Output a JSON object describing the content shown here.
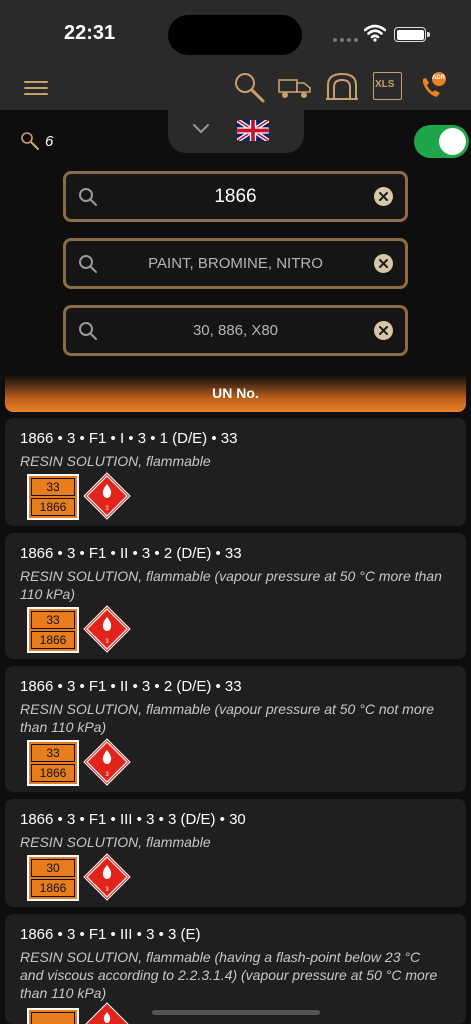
{
  "status": {
    "time": "22:31"
  },
  "nav": {
    "icons": [
      "menu-icon",
      "search-icon",
      "truck-icon",
      "tunnel-icon",
      "xls-icon",
      "adr-phone-icon"
    ],
    "xls_label": "XLS",
    "adr_label": "ADR"
  },
  "header": {
    "result_count": "6",
    "toggle_on": true
  },
  "colors": {
    "accent": "#e98125",
    "field_border": "#8a6d44",
    "toggle": "#1fa64a",
    "hazard": "#e2231a"
  },
  "search": {
    "un_value": "1866",
    "name_placeholder": "PAINT, BROMINE, NITRO",
    "code_placeholder": "30, 886, X80"
  },
  "section_title": "UN No.",
  "results": [
    {
      "title": "1866 • 3 • F1 • I • 3 • 1 (D/E) • 33",
      "description": "RESIN SOLUTION, flammable",
      "plate_top": "33",
      "plate_bottom": "1866",
      "label_class": "3"
    },
    {
      "title": "1866 • 3 • F1 • II • 3 • 2 (D/E) • 33",
      "description": "RESIN SOLUTION, flammable (vapour pressure at 50 °C more than 110 kPa)",
      "plate_top": "33",
      "plate_bottom": "1866",
      "label_class": "3"
    },
    {
      "title": "1866 • 3 • F1 • II • 3 • 2 (D/E) • 33",
      "description": "RESIN SOLUTION, flammable (vapour pressure at 50 °C not more than 110 kPa)",
      "plate_top": "33",
      "plate_bottom": "1866",
      "label_class": "3"
    },
    {
      "title": "1866 • 3 • F1 • III • 3 • 3 (D/E) • 30",
      "description": "RESIN SOLUTION, flammable",
      "plate_top": "30",
      "plate_bottom": "1866",
      "label_class": "3"
    },
    {
      "title": "1866 • 3 • F1 • III • 3 • 3 (E)",
      "description": "RESIN SOLUTION, flammable (having a flash-point below 23 °C and viscous according to 2.2.3.1.4) (vapour pressure at 50 °C more than 110 kPa)",
      "plate_top": "",
      "plate_bottom": "",
      "label_class": "3"
    }
  ]
}
